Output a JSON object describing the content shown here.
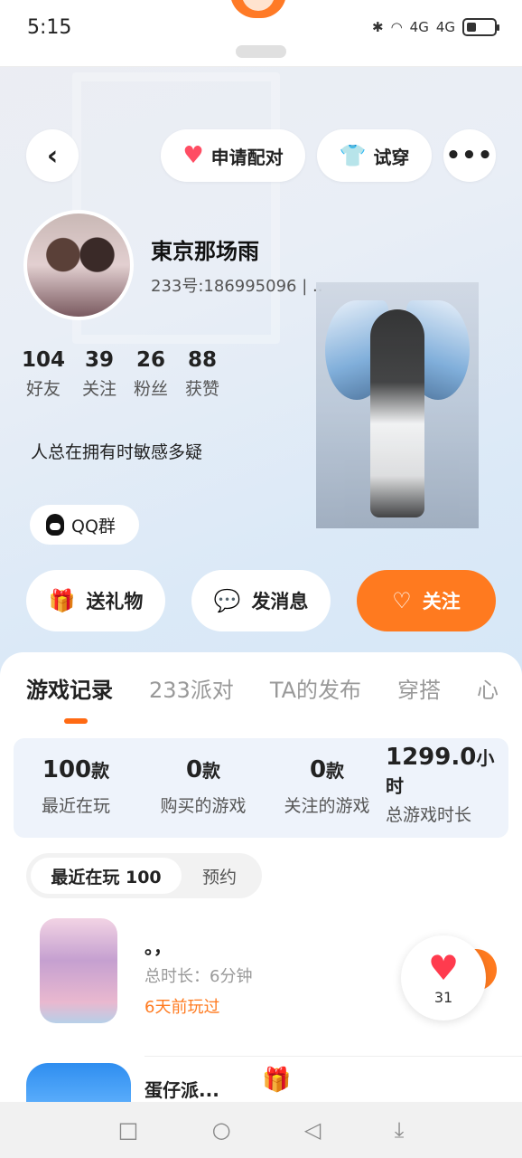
{
  "status_bar": {
    "time": "5:15",
    "signal_1": "4G",
    "signal_2": "4G"
  },
  "header": {
    "match_label": "申请配对",
    "tryon_label": "试穿",
    "more_label": "•••"
  },
  "profile": {
    "nickname": "東京那场雨",
    "uid": "233号:186995096 | ..",
    "stats": [
      {
        "value": "104",
        "label": "好友"
      },
      {
        "value": "39",
        "label": "关注"
      },
      {
        "value": "26",
        "label": "粉丝"
      },
      {
        "value": "88",
        "label": "获赞"
      }
    ],
    "bio": "人总在拥有时敏感多疑",
    "qq_group_label": "QQ群"
  },
  "actions": {
    "gift_label": "送礼物",
    "message_label": "发消息",
    "follow_label": "关注"
  },
  "tabs": [
    "游戏记录",
    "233派对",
    "TA的发布",
    "穿搭",
    "心"
  ],
  "summary": [
    {
      "value": "100",
      "unit": "款",
      "label": "最近在玩"
    },
    {
      "value": "0",
      "unit": "款",
      "label": "购买的游戏"
    },
    {
      "value": "0",
      "unit": "款",
      "label": "关注的游戏"
    },
    {
      "value": "1299.0",
      "unit": "小",
      "unit2": "时",
      "label": "总游戏时长"
    }
  ],
  "filter": {
    "active_label": "最近在玩 100",
    "other_label": "预约"
  },
  "games": [
    {
      "title": "。，",
      "playtime": "总时长：6分钟",
      "recent": "6天前玩过"
    },
    {
      "title": "蛋仔派..."
    }
  ],
  "like_fab": {
    "count": "31"
  },
  "colors": {
    "accent": "#ff7a1f",
    "like": "#ff3b4e"
  }
}
